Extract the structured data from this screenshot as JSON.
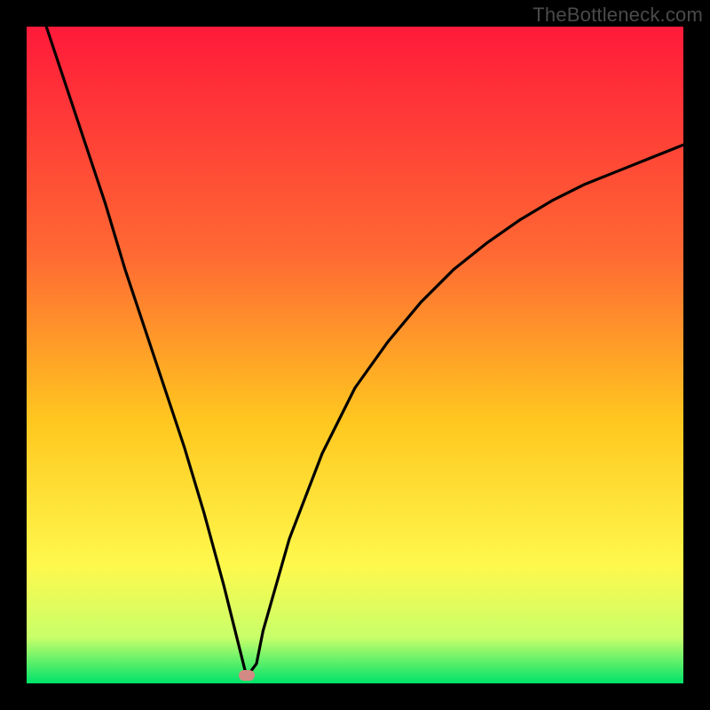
{
  "watermark": "TheBottleneck.com",
  "colors": {
    "gradient_top": "#ff1a3a",
    "gradient_mid1": "#ff6a33",
    "gradient_mid2": "#ffc71f",
    "gradient_mid3": "#fff84c",
    "gradient_mid4": "#c8ff6a",
    "gradient_bottom": "#00e26a",
    "curve": "#000000",
    "marker": "#d48a84"
  },
  "chart_data": {
    "type": "line",
    "title": "",
    "xlabel": "",
    "ylabel": "",
    "xlim": [
      0,
      100
    ],
    "ylim": [
      0,
      100
    ],
    "grid": false,
    "legend": false,
    "series": [
      {
        "name": "bottleneck-curve",
        "x": [
          3,
          6,
          9,
          12,
          15,
          18,
          21,
          24,
          27,
          30,
          32,
          33.5,
          35,
          36,
          40,
          45,
          50,
          55,
          60,
          65,
          70,
          75,
          80,
          85,
          90,
          95,
          100
        ],
        "y": [
          100,
          91,
          82,
          73,
          63,
          54,
          45,
          36,
          26,
          15,
          7,
          1,
          3,
          8,
          22,
          35,
          45,
          52,
          58,
          63,
          67,
          70.5,
          73.5,
          76,
          78,
          80,
          82
        ]
      }
    ],
    "marker": {
      "x_pct": 33.5,
      "y_pct_from_bottom": 1.2
    }
  }
}
